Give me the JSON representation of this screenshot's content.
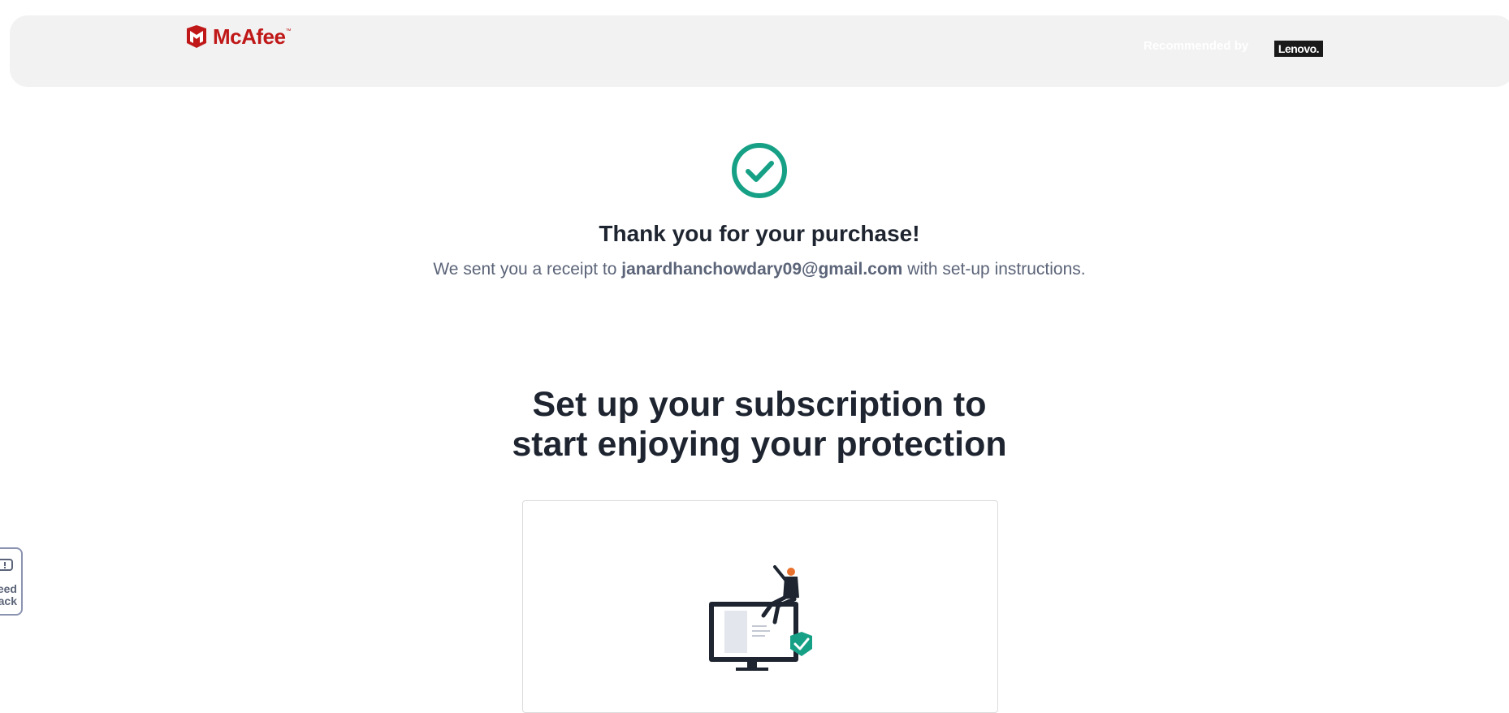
{
  "header": {
    "brand": "McAfee",
    "brand_tm": "™",
    "recommended_label": "Recommended by",
    "partner": "Lenovo."
  },
  "confirmation": {
    "title": "Thank you for your purchase!",
    "receipt_prefix": "We sent you a receipt to ",
    "email": "janardhanchowdary09@gmail.com",
    "receipt_suffix": " with set-up instructions."
  },
  "setup": {
    "title_line1": "Set up your subscription to",
    "title_line2": "start enjoying your protection"
  },
  "feedback": {
    "line1": "Feed",
    "line2": "back"
  },
  "colors": {
    "brand_red": "#c01818",
    "success_green": "#16a085",
    "header_bg": "#f2f2f2",
    "text_dark": "#1e2530",
    "text_muted": "#5b6478"
  }
}
